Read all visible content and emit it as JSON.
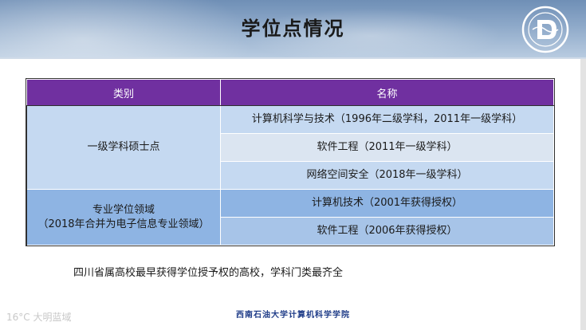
{
  "slide": {
    "title": "学位点情况"
  },
  "table": {
    "headers": [
      "类别",
      "名称"
    ],
    "groups": [
      {
        "category_line1": "一级学科硕士点",
        "category_line2": "",
        "items": [
          "计算机科学与技术（1996年二级学科，2011年一级学科）",
          "软件工程（2011年一级学科）",
          "网络空间安全（2018年一级学科）"
        ]
      },
      {
        "category_line1": "专业学位领域",
        "category_line2": "（2018年合并为电子信息专业领域）",
        "items": [
          "计算机技术（2001年获得授权）",
          "软件工程（2006年获得授权）"
        ]
      }
    ]
  },
  "note": "四川省属高校最早获得学位授予权的高校，学科门类最齐全",
  "footer": "西南石油大学计算机科学学院",
  "watermark": "16°C 大明蓝域",
  "colors": {
    "header_purple": "#7030a0",
    "group1_bg": "#c5d9f1",
    "group2_bg": "#8eb4e3",
    "footer_blue": "#1f3c88"
  }
}
